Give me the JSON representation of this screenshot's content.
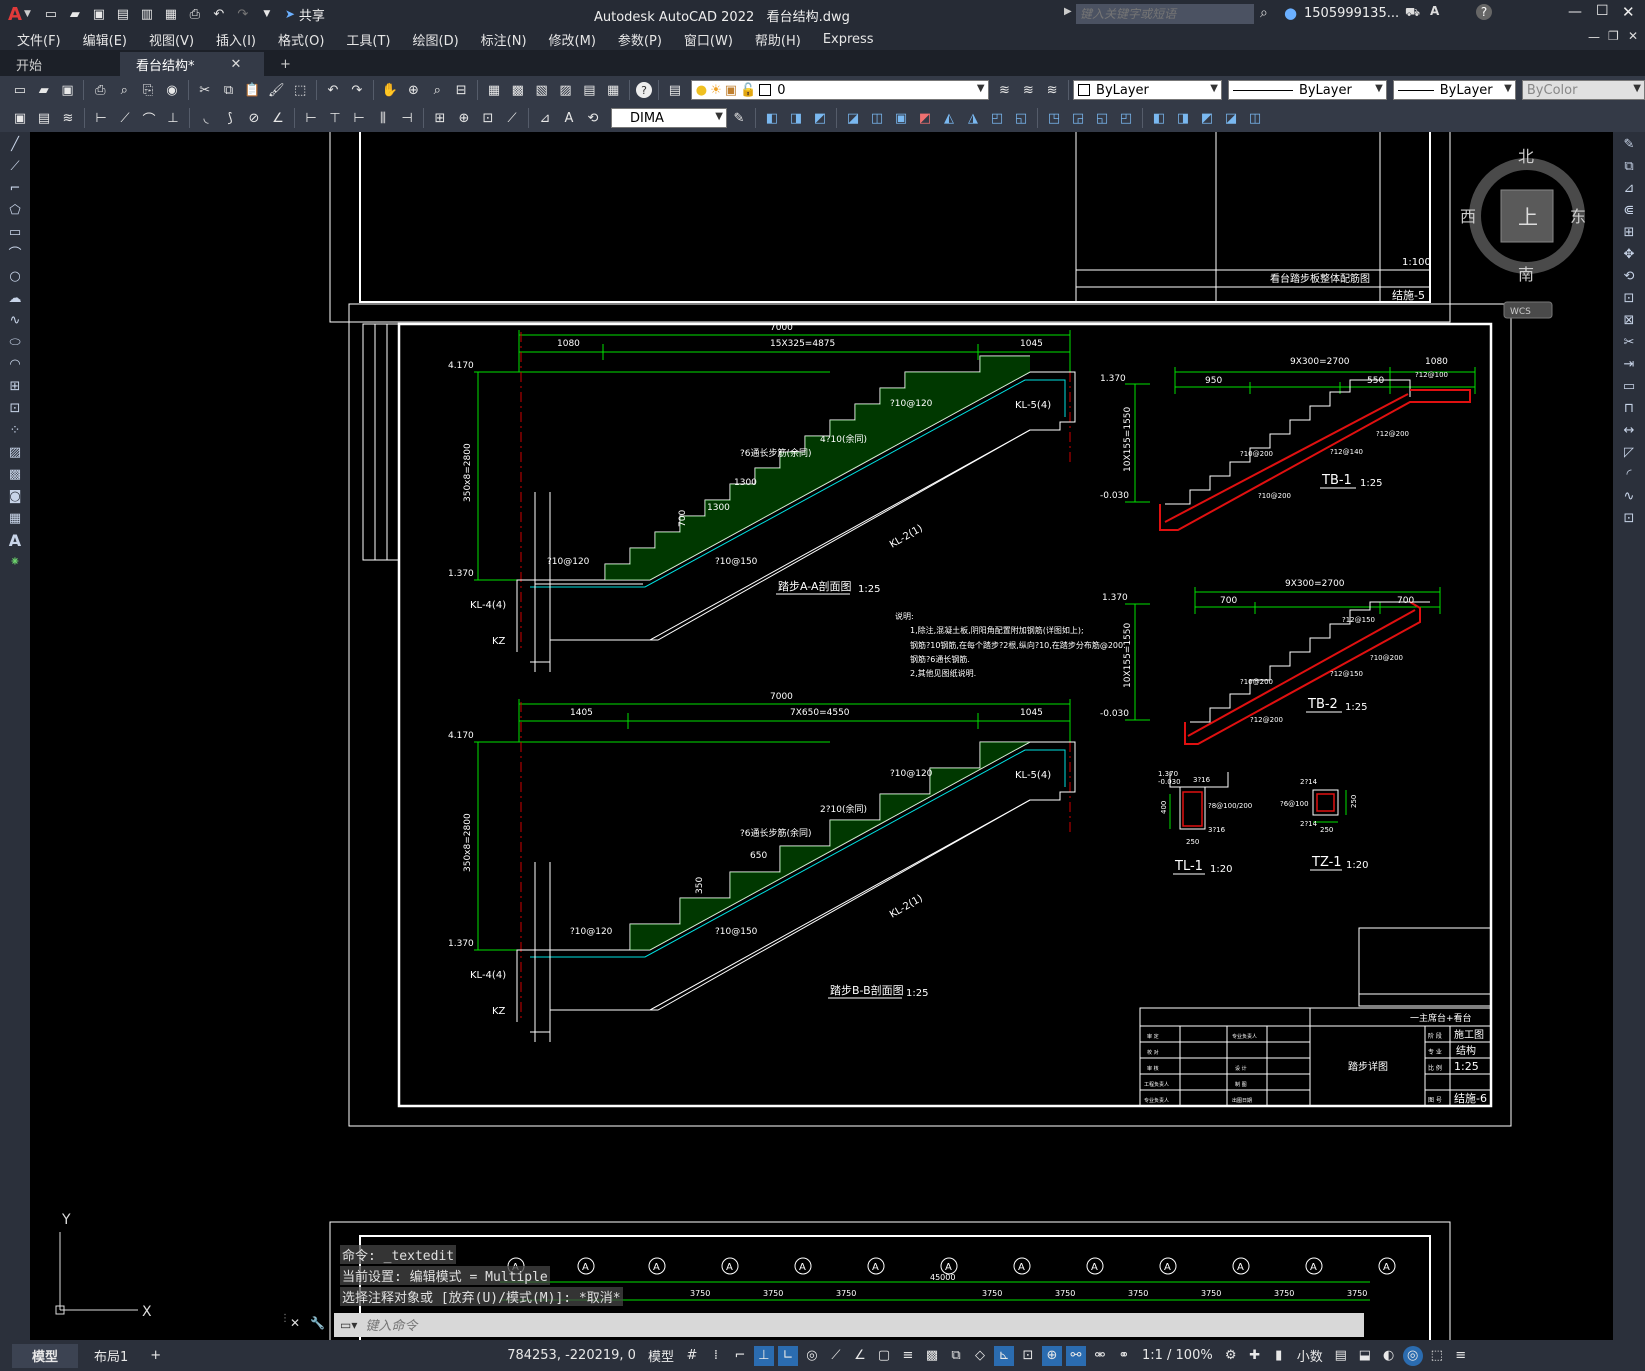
{
  "app": {
    "title": "Autodesk AutoCAD 2022",
    "file": "看台结构.dwg",
    "share_label": "共享",
    "search_placeholder": "键入关键字或短语",
    "user": "1505999135..."
  },
  "menu": [
    "文件(F)",
    "编辑(E)",
    "视图(V)",
    "插入(I)",
    "格式(O)",
    "工具(T)",
    "绘图(D)",
    "标注(N)",
    "修改(M)",
    "参数(P)",
    "窗口(W)",
    "帮助(H)",
    "Express"
  ],
  "tabs": [
    {
      "label": "开始"
    },
    {
      "label": "看台结构*"
    }
  ],
  "toolbar": {
    "layer_value": "0",
    "dim_style": "DIMA",
    "color": "ByLayer",
    "linetype": "ByLayer",
    "lineweight": "ByLayer",
    "plotstyle": "ByColor"
  },
  "viewcube": {
    "north": "北",
    "south": "南",
    "east": "东",
    "west": "西",
    "top": "上",
    "wcs": "WCS"
  },
  "ucs": {
    "x": "X",
    "y": "Y"
  },
  "drawing": {
    "top_sheet_no": "结施-5",
    "top_sheet_title": "看台踏步板整体配筋图",
    "top_scale": "1:100",
    "aa": {
      "title": "踏步A-A剖面图",
      "scale": "1:25",
      "dim_total": "7000",
      "dim_left": "1080",
      "dim_mid": "15X325=4875",
      "dim_right": "1045",
      "elev_top": "4.170",
      "elev_bottom": "1.370",
      "height": "350x8=2800",
      "kl_top": "KL-5(4)",
      "kl_left": "KL-4(4)",
      "kl_diag": "KL-2(1)",
      "kz": "KZ",
      "rebar1": "?10@120",
      "rebar2": "4?10(余同)",
      "rebar3": "?6通长步筋(余同)",
      "rebar4": "?10@150",
      "rebar5": "?10@120",
      "d1300a": "1300",
      "d1300b": "1300",
      "d700": "700"
    },
    "bb": {
      "title": "踏步B-B剖面图",
      "scale": "1:25",
      "dim_total": "7000",
      "dim_left": "1405",
      "dim_mid": "7X650=4550",
      "dim_right": "1045",
      "elev_top": "4.170",
      "elev_bottom": "1.370",
      "height": "350x8=2800",
      "kl_top": "KL-5(4)",
      "kl_left": "KL-4(4)",
      "kl_diag": "KL-2(1)",
      "kz": "KZ",
      "rebar1": "?10@120",
      "rebar2": "2?10(余同)",
      "rebar3": "?6通长步筋(余同)",
      "rebar4": "?10@150",
      "rebar5": "?10@120",
      "d650": "650",
      "d350": "350"
    },
    "tb1": {
      "label": "TB-1",
      "scale": "1:25",
      "dim_total": "9X300=2700",
      "dim_left": "950",
      "dim_mid": "550",
      "dim_right": "1080",
      "elev_top": "1.370",
      "elev_bottom": "-0.030",
      "height": "10X155=1550",
      "r1": "?12@100",
      "r2": "?12@200",
      "r3": "?12@140",
      "r4": "?10@200",
      "r5": "?10@200"
    },
    "tb2": {
      "label": "TB-2",
      "scale": "1:25",
      "dim_total": "9X300=2700",
      "dim_left": "700",
      "dim_right": "700",
      "elev_top": "1.370",
      "elev_bottom": "-0.030",
      "height": "10X155=1550",
      "r1": "?12@150",
      "r2": "?10@200",
      "r3": "?12@150",
      "r4": "?10@200",
      "r5": "?12@200"
    },
    "tl1": {
      "label": "TL-1",
      "scale": "1:20",
      "e1": "1.370",
      "e2": "-0.030",
      "r1": "3?16",
      "r2": "?8@100/200",
      "r3": "3?16",
      "w": "250",
      "h": "400"
    },
    "tz1": {
      "label": "TZ-1",
      "scale": "1:20",
      "r1": "2?14",
      "r2": "?6@100",
      "r3": "2?14",
      "w": "250",
      "h": "250"
    },
    "notes": {
      "heading": "说明:",
      "l1": "1,除注,混凝土板,阴阳角配置附加钢筋(详图如上);",
      "l2": "   钢筋?10钢筋,在每个踏步?2根,纵向?10,在踏步分布筋@200.",
      "l3": "   钢筋?6通长钢筋.",
      "l4": "2,其他见图纸说明."
    },
    "titleblock": {
      "project": "一主席台+看台",
      "drawing_name": "踏步详图",
      "stage": "施工图",
      "discipline": "结构",
      "scale": "1:25",
      "sheet": "结施-6",
      "rows": [
        "审 定",
        "校 对",
        "审 核",
        "工程负责人",
        "专业负责人"
      ],
      "rows2": [
        "专业负责人",
        "设 计",
        "制 图",
        "出图日期"
      ],
      "side_labels": [
        "阶 段",
        "专 业",
        "比 例",
        "图 号"
      ]
    },
    "bottom": {
      "axis_labels": [
        "A",
        "A",
        "A",
        "A",
        "A",
        "A",
        "A",
        "A",
        "A",
        "A",
        "A",
        "A",
        "A"
      ],
      "spacing": "3750",
      "total": "45000"
    }
  },
  "command": {
    "line1": "命令: _textedit",
    "line2": "当前设置: 编辑模式 = Multiple",
    "line3": "选择注释对象或 [放弃(U)/模式(M)]: *取消*",
    "placeholder": "键入命令"
  },
  "status": {
    "model_tab": "模型",
    "layout_tab": "布局1",
    "coords": "784253, -220219, 0",
    "mode": "模型",
    "scale": "1:1 / 100%",
    "units": "小数"
  }
}
